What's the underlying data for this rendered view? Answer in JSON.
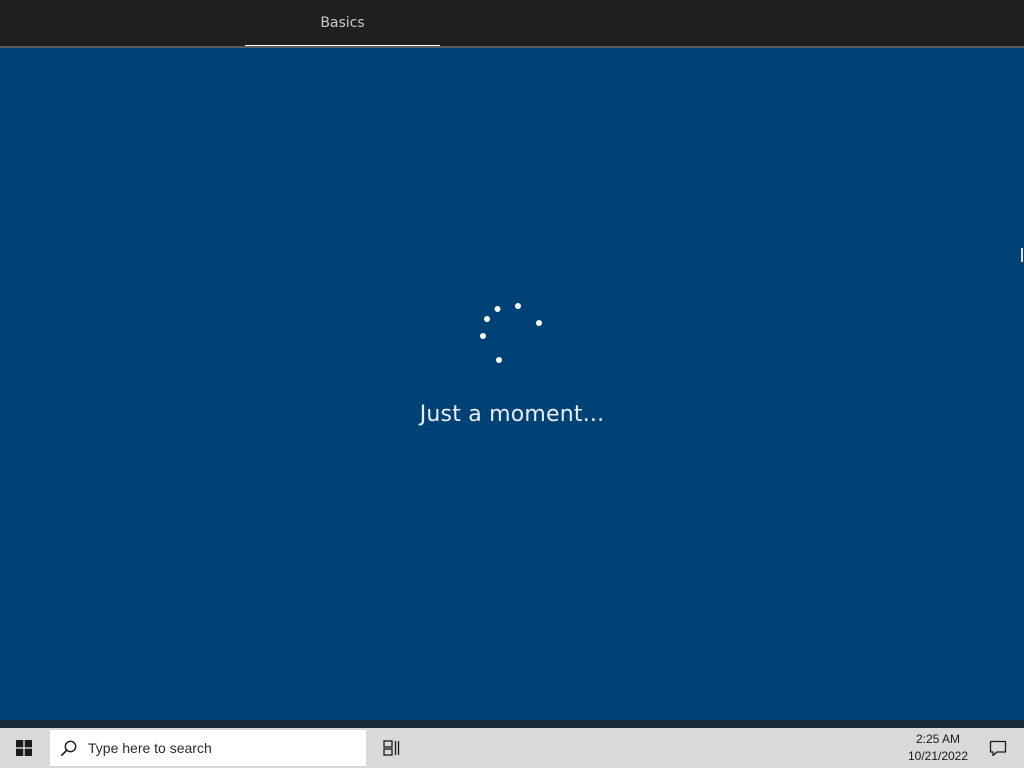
{
  "header": {
    "tabs": [
      {
        "label": "Basics",
        "active": true
      }
    ]
  },
  "main": {
    "status_text": "Just a moment..."
  },
  "taskbar": {
    "start_icon": "windows-logo-icon",
    "search": {
      "icon": "search-icon",
      "placeholder": "Type here to search"
    },
    "task_view_icon": "task-view-icon",
    "clock": {
      "time": "2:25 AM",
      "date": "10/21/2022"
    },
    "notification_icon": "notification-icon"
  },
  "colors": {
    "background": "#004275",
    "topbar": "#1f1f1f",
    "taskbar": "#d9d9d9",
    "accent_white": "#ffffff"
  }
}
